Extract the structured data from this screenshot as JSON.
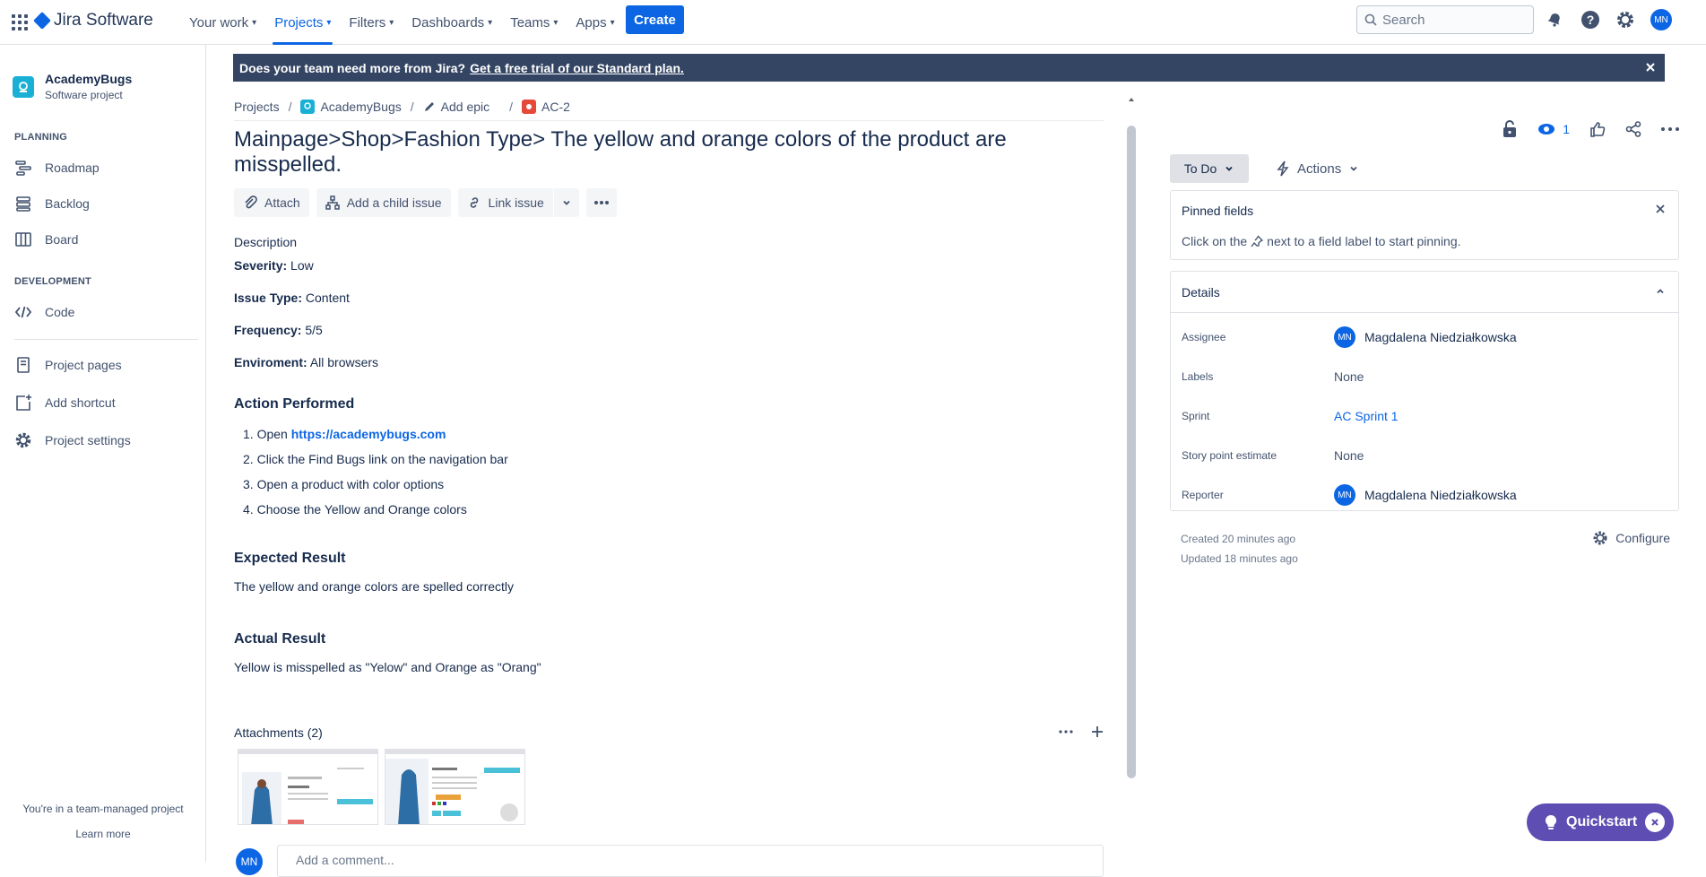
{
  "topnav": {
    "product": "Jira Software",
    "menu": [
      {
        "label": "Your work",
        "active": false
      },
      {
        "label": "Projects",
        "active": true
      },
      {
        "label": "Filters",
        "active": false
      },
      {
        "label": "Dashboards",
        "active": false
      },
      {
        "label": "Teams",
        "active": false
      },
      {
        "label": "Apps",
        "active": false
      }
    ],
    "create_label": "Create",
    "search_placeholder": "Search",
    "user_initials": "MN",
    "accent": "#0c66e4",
    "icons": [
      "app-switcher-icon",
      "notifications-icon",
      "help-icon",
      "settings-icon"
    ]
  },
  "sidebar": {
    "project_name": "AcademyBugs",
    "project_type": "Software project",
    "planning_label": "PLANNING",
    "planning_items": [
      {
        "label": "Roadmap",
        "icon": "roadmap-icon"
      },
      {
        "label": "Backlog",
        "icon": "backlog-icon"
      },
      {
        "label": "Board",
        "icon": "board-icon"
      }
    ],
    "development_label": "DEVELOPMENT",
    "development_items": [
      {
        "label": "Code",
        "icon": "code-icon"
      }
    ],
    "other_items": [
      {
        "label": "Project pages",
        "icon": "pages-icon"
      },
      {
        "label": "Add shortcut",
        "icon": "add-shortcut-icon"
      },
      {
        "label": "Project settings",
        "icon": "settings-icon"
      }
    ],
    "footer_text": "You're in a team-managed project",
    "footer_link": "Learn more"
  },
  "banner": {
    "text": "Does your team need more from Jira?",
    "link": "Get a free trial of our Standard plan."
  },
  "breadcrumb": {
    "items": [
      "Projects",
      "AcademyBugs",
      "Add epic",
      "AC-2"
    ]
  },
  "issue": {
    "title": "Mainpage>Shop>Fashion Type> The yellow and orange colors of the product are misspelled.",
    "actions": {
      "attach": "Attach",
      "child": "Add a child issue",
      "link": "Link issue"
    },
    "description_label": "Description",
    "fields": [
      {
        "key": "Severity:",
        "value": "Low"
      },
      {
        "key": "Issue Type:",
        "value": "Content"
      },
      {
        "key": "Frequency:",
        "value": "5/5"
      },
      {
        "key": "Enviroment:",
        "value": "All browsers"
      }
    ],
    "action_performed": {
      "heading": "Action Performed",
      "steps": [
        {
          "num": "1.",
          "text": "Open ",
          "link": "https://academybugs.com"
        },
        {
          "num": "2.",
          "text": "Click the Find Bugs link on the navigation bar"
        },
        {
          "num": "3.",
          "text": "Open a product with color options"
        },
        {
          "num": "4.",
          "text": "Choose the Yellow and Orange colors"
        }
      ]
    },
    "expected": {
      "heading": "Expected Result",
      "text": "The yellow and orange colors are spelled correctly"
    },
    "actual": {
      "heading": "Actual Result",
      "text": "Yellow is misspelled as \"Yelow\" and Orange as \"Orang\""
    },
    "attachments_label": "Attachments (2)",
    "comment_placeholder": "Add a comment...",
    "comment_user": "MN"
  },
  "right_panel": {
    "watchers": "1",
    "status": "To Do",
    "actions_label": "Actions",
    "pinned": {
      "title": "Pinned fields",
      "text_before": "Click on the",
      "text_after": "next to a field label to start pinning."
    },
    "details": {
      "title": "Details",
      "rows": [
        {
          "label": "Assignee",
          "value": "Magdalena Niedziałkowska",
          "avatar": "MN"
        },
        {
          "label": "Labels",
          "value": "None"
        },
        {
          "label": "Sprint",
          "value": "AC Sprint 1"
        },
        {
          "label": "Story point estimate",
          "value": "None"
        },
        {
          "label": "Reporter",
          "value": "Magdalena Niedziałkowska",
          "avatar": "MN"
        }
      ]
    },
    "created": "Created 20 minutes ago",
    "updated": "Updated 18 minutes ago",
    "configure": "Configure"
  },
  "quickstart": {
    "label": "Quickstart"
  }
}
